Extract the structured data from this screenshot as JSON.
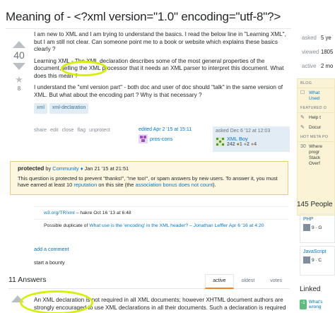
{
  "question": {
    "title": "Meaning of - <?xml version=\"1.0\" encoding=\"utf-8\"?>",
    "score": "40",
    "favorites": "8",
    "paragraphs": [
      "I am new to XML and I am trying to understand the basics. I read the below line in \"Learning XML\", but I am still not clear. Can someone point me to a book or website which explains these basics clearly ?",
      "Learning XML - The XML declaration describes some of the most general properties of the document, telling the XML processor that it needs an XML parser to interpret this document. What does this mean ?",
      "I understand the \"xml version part\" - both doc and user of doc should \"talk\" in the same version of XML. But what about the encoding part ? Why is that necessary ?"
    ],
    "tags": [
      "xml",
      "xml-declaration"
    ],
    "menu": [
      "share",
      "edit",
      "close",
      "flag",
      "unprotect"
    ],
    "edited": {
      "label": "edited Apr 2 '15 at 15:11",
      "user": "pros-cons"
    },
    "asked": {
      "label": "asked Dec 6 '12 at 12:03",
      "user": "XML Boy",
      "rep": "242",
      "gold": "1",
      "silver": "2",
      "bronze": "4"
    }
  },
  "notice": {
    "strong": "protected",
    "by": "by",
    "user": "Community",
    "date": "Jan 21 '15 at 21:51",
    "line1": "This question is protected to prevent \"thanks!\", \"me too!\", or spam answers by new users. To answer it, you must have earned at least 10",
    "reputation_link": "reputation",
    "line2": "on this site (the",
    "bonus_link": "association bonus does not count",
    "line3": ")."
  },
  "comments": [
    {
      "link": "w3.org/TR/xml",
      "rest": "– hakre Oct 16 '13 at 6:48"
    },
    {
      "prefix": "Possible duplicate of",
      "link": "What use is the 'encoding' in the XML header?",
      "rest": "– Jonathan Leffler Apr 6 '16 at 4:20"
    }
  ],
  "add_comment": "add a comment",
  "bounty": "start a bounty",
  "answers": {
    "count": "11 Answers",
    "tabs": [
      "active",
      "oldest",
      "votes"
    ],
    "first_text": "An XML declaration is not required in all XML documents; however XHTML document authors are strongly encouraged to use XML declarations in all their documents. Such a declaration is required"
  },
  "sidebar": {
    "stats": [
      {
        "label": "asked",
        "value": "5 ye"
      },
      {
        "label": "viewed",
        "value": "1805"
      },
      {
        "label": "active",
        "value": "2 mo"
      }
    ],
    "blog_header": "BLOG",
    "blog_items": [
      {
        "icon": "☐",
        "text": "What Used"
      }
    ],
    "featured_header": "FEATURED O",
    "featured_items": [
      {
        "icon": "✎",
        "text": "Help t"
      },
      {
        "icon": "✎",
        "text": "Docur"
      }
    ],
    "hot_header": "HOT META PO",
    "hot_items": [
      {
        "icon": "30",
        "text": "Where progr Stack Overf"
      }
    ],
    "people_title": "145 People",
    "php_title": "PHP",
    "php_row": "9 · G",
    "js_title": "JavaScript",
    "js_row": "9 · C",
    "linked_title": "Linked",
    "linked_score": "-1",
    "linked_text": "What's wrong"
  },
  "colors": {
    "accent": "#d6f000",
    "link": "#0077cc",
    "tag_bg": "#e1ecf4",
    "notice_bg": "#fdf7e2"
  }
}
